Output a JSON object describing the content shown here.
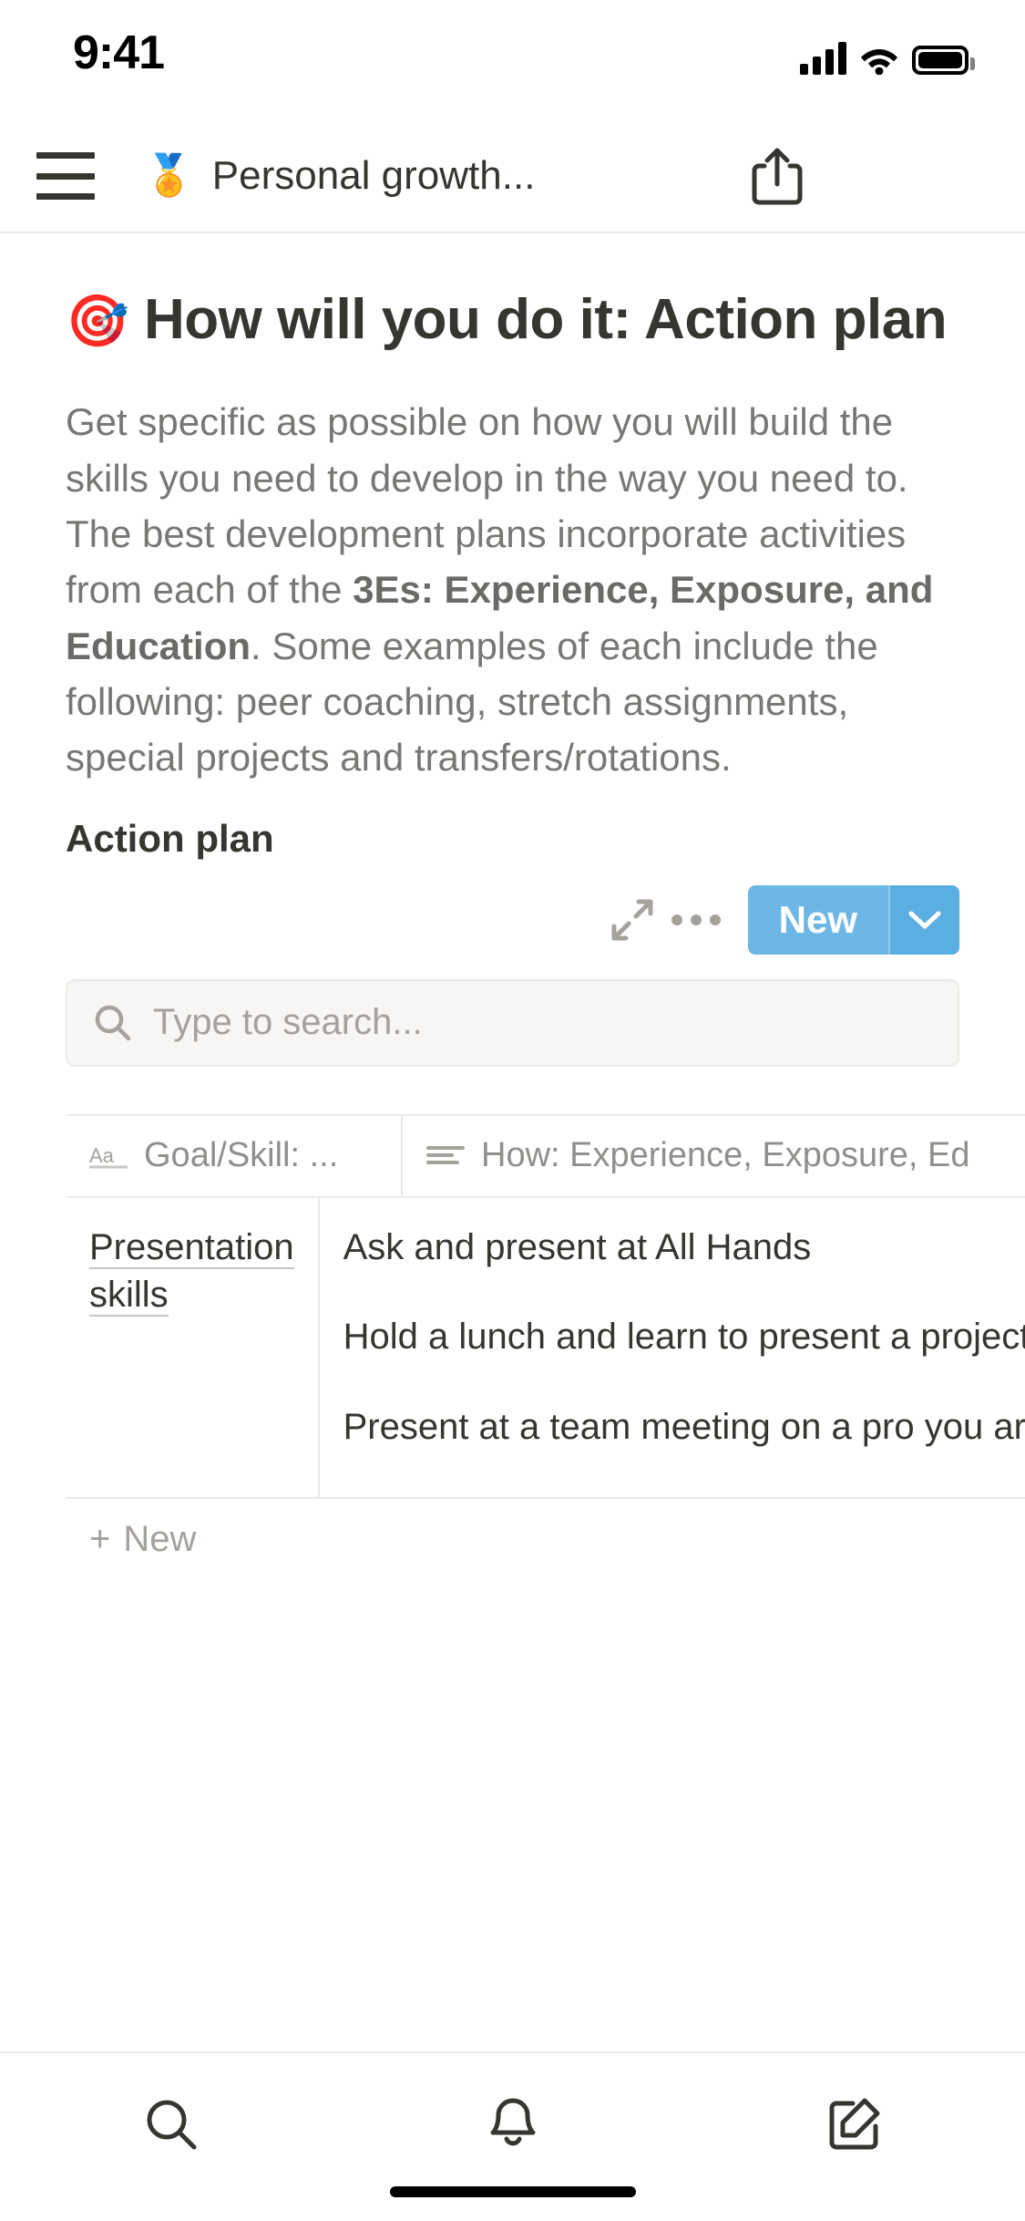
{
  "status_bar": {
    "time": "9:41",
    "signal_icon": "cellular-bars-icon",
    "wifi_icon": "wifi-icon",
    "battery_icon": "battery-full-icon"
  },
  "nav": {
    "menu_icon": "hamburger-menu-icon",
    "page_emoji": "🏅",
    "page_title": "Personal growth...",
    "share_icon": "share-icon"
  },
  "page": {
    "title_emoji": "🎯",
    "title": "How will you do it: Action plan",
    "body_part1": "Get specific as possible on how you will build the skills you need to develop in the way you need to. The best development plans incorporate activities from each of the ",
    "body_bold": "3Es: Experience, Exposure, and Education",
    "body_part2": ". Some examples of each include the following: peer coaching, stretch assignments, special projects and transfers/rotations.",
    "section_title": "Action plan"
  },
  "db_toolbar": {
    "expand_icon": "expand-diagonal-icon",
    "more_icon": "ellipsis-icon",
    "new_label": "New",
    "caret_icon": "chevron-down-icon",
    "accent_color": "#6cb7e6"
  },
  "search": {
    "icon": "search-icon",
    "placeholder": "Type to search...",
    "value": ""
  },
  "table": {
    "columns": [
      {
        "icon": "text-type-icon",
        "label": "Goal/Skill: ..."
      },
      {
        "icon": "rich-text-icon",
        "label": "How: Experience, Exposure, Ed"
      }
    ],
    "rows": [
      {
        "goal": "Presentation skills",
        "how": [
          "Ask and present at All Hands",
          "Hold a lunch and learn to present a project you are working on",
          "Present at a team meeting on a pro you are working on"
        ]
      }
    ],
    "new_row_label": "New",
    "new_row_icon": "plus-icon"
  },
  "tabbar": {
    "items": [
      {
        "name": "search",
        "icon": "search-icon"
      },
      {
        "name": "updates",
        "icon": "bell-icon"
      },
      {
        "name": "new-page",
        "icon": "compose-icon"
      }
    ]
  }
}
